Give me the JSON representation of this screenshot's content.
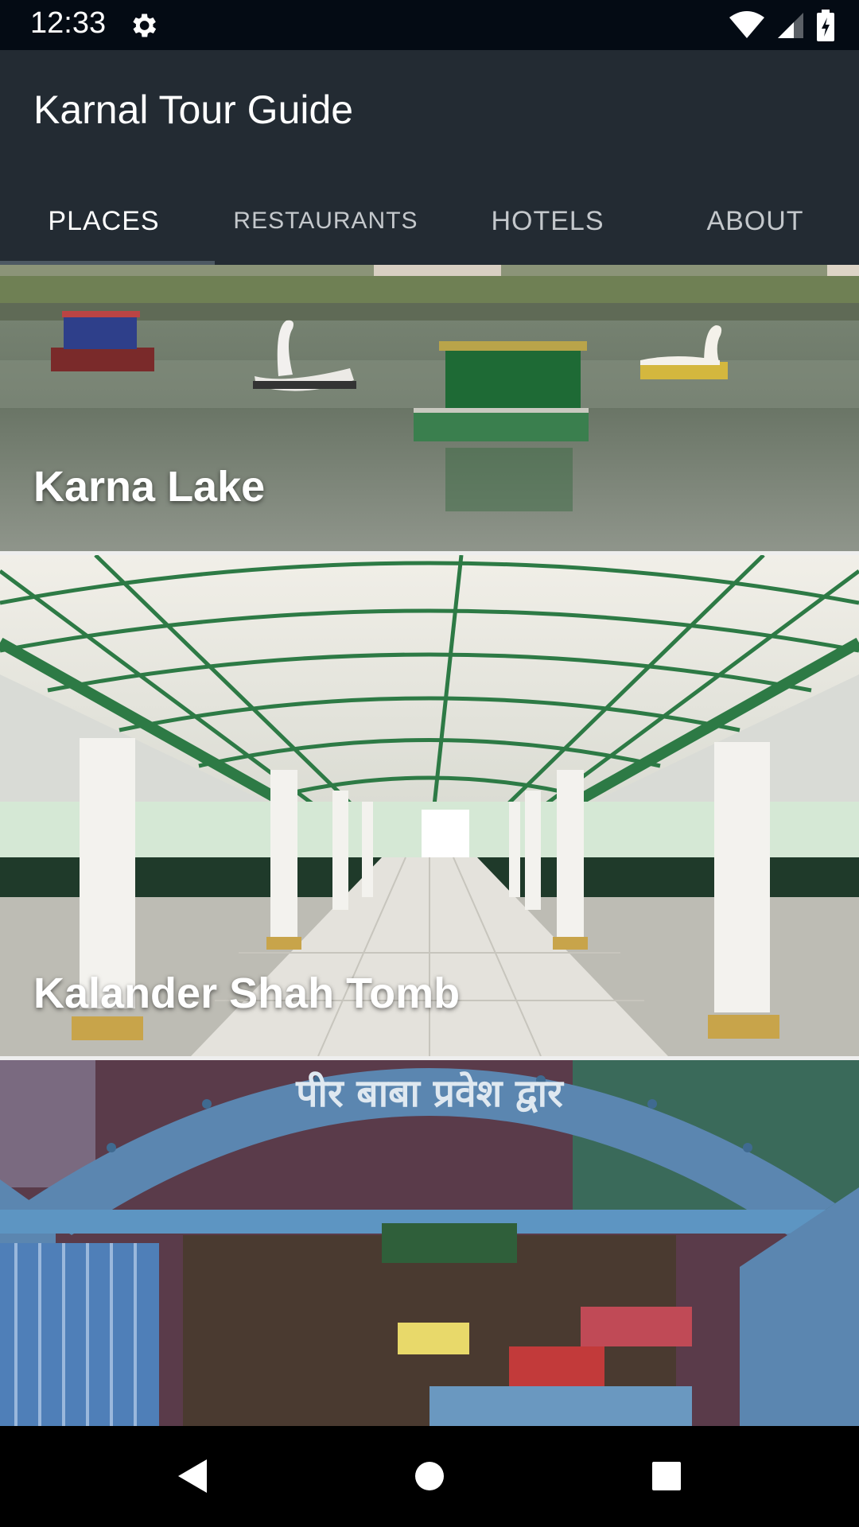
{
  "status_bar": {
    "time": "12:33",
    "icons": [
      "gear-icon",
      "wifi-icon",
      "signal-icon",
      "battery-icon"
    ]
  },
  "app": {
    "title": "Karnal Tour Guide",
    "colors": {
      "app_bar": "#232b33",
      "status_bar": "#040b14"
    }
  },
  "tabs": [
    {
      "label": "PLACES",
      "active": true
    },
    {
      "label": "RESTAURANTS",
      "active": false
    },
    {
      "label": "HOTELS",
      "active": false
    },
    {
      "label": "ABOUT",
      "active": false
    }
  ],
  "places": [
    {
      "name": "Karna Lake"
    },
    {
      "name": "Kalander Shah Tomb"
    },
    {
      "name": "",
      "sign_text": "पीर बाबा प्रवेश द्वार"
    }
  ],
  "nav_bar": {
    "icons": [
      "back-icon",
      "home-icon",
      "recents-icon"
    ]
  }
}
